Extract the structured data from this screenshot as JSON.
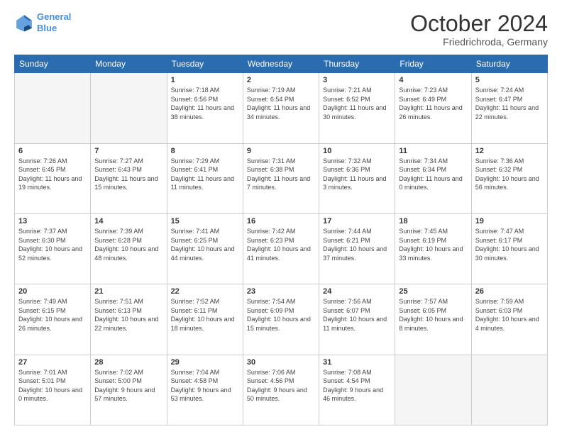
{
  "header": {
    "logo_line1": "General",
    "logo_line2": "Blue",
    "title": "October 2024",
    "subtitle": "Friedrichroda, Germany"
  },
  "weekdays": [
    "Sunday",
    "Monday",
    "Tuesday",
    "Wednesday",
    "Thursday",
    "Friday",
    "Saturday"
  ],
  "weeks": [
    [
      {
        "day": "",
        "sunrise": "",
        "sunset": "",
        "daylight": "",
        "empty": true
      },
      {
        "day": "",
        "sunrise": "",
        "sunset": "",
        "daylight": "",
        "empty": true
      },
      {
        "day": "1",
        "sunrise": "Sunrise: 7:18 AM",
        "sunset": "Sunset: 6:56 PM",
        "daylight": "Daylight: 11 hours and 38 minutes.",
        "empty": false
      },
      {
        "day": "2",
        "sunrise": "Sunrise: 7:19 AM",
        "sunset": "Sunset: 6:54 PM",
        "daylight": "Daylight: 11 hours and 34 minutes.",
        "empty": false
      },
      {
        "day": "3",
        "sunrise": "Sunrise: 7:21 AM",
        "sunset": "Sunset: 6:52 PM",
        "daylight": "Daylight: 11 hours and 30 minutes.",
        "empty": false
      },
      {
        "day": "4",
        "sunrise": "Sunrise: 7:23 AM",
        "sunset": "Sunset: 6:49 PM",
        "daylight": "Daylight: 11 hours and 26 minutes.",
        "empty": false
      },
      {
        "day": "5",
        "sunrise": "Sunrise: 7:24 AM",
        "sunset": "Sunset: 6:47 PM",
        "daylight": "Daylight: 11 hours and 22 minutes.",
        "empty": false
      }
    ],
    [
      {
        "day": "6",
        "sunrise": "Sunrise: 7:26 AM",
        "sunset": "Sunset: 6:45 PM",
        "daylight": "Daylight: 11 hours and 19 minutes.",
        "empty": false
      },
      {
        "day": "7",
        "sunrise": "Sunrise: 7:27 AM",
        "sunset": "Sunset: 6:43 PM",
        "daylight": "Daylight: 11 hours and 15 minutes.",
        "empty": false
      },
      {
        "day": "8",
        "sunrise": "Sunrise: 7:29 AM",
        "sunset": "Sunset: 6:41 PM",
        "daylight": "Daylight: 11 hours and 11 minutes.",
        "empty": false
      },
      {
        "day": "9",
        "sunrise": "Sunrise: 7:31 AM",
        "sunset": "Sunset: 6:38 PM",
        "daylight": "Daylight: 11 hours and 7 minutes.",
        "empty": false
      },
      {
        "day": "10",
        "sunrise": "Sunrise: 7:32 AM",
        "sunset": "Sunset: 6:36 PM",
        "daylight": "Daylight: 11 hours and 3 minutes.",
        "empty": false
      },
      {
        "day": "11",
        "sunrise": "Sunrise: 7:34 AM",
        "sunset": "Sunset: 6:34 PM",
        "daylight": "Daylight: 11 hours and 0 minutes.",
        "empty": false
      },
      {
        "day": "12",
        "sunrise": "Sunrise: 7:36 AM",
        "sunset": "Sunset: 6:32 PM",
        "daylight": "Daylight: 10 hours and 56 minutes.",
        "empty": false
      }
    ],
    [
      {
        "day": "13",
        "sunrise": "Sunrise: 7:37 AM",
        "sunset": "Sunset: 6:30 PM",
        "daylight": "Daylight: 10 hours and 52 minutes.",
        "empty": false
      },
      {
        "day": "14",
        "sunrise": "Sunrise: 7:39 AM",
        "sunset": "Sunset: 6:28 PM",
        "daylight": "Daylight: 10 hours and 48 minutes.",
        "empty": false
      },
      {
        "day": "15",
        "sunrise": "Sunrise: 7:41 AM",
        "sunset": "Sunset: 6:25 PM",
        "daylight": "Daylight: 10 hours and 44 minutes.",
        "empty": false
      },
      {
        "day": "16",
        "sunrise": "Sunrise: 7:42 AM",
        "sunset": "Sunset: 6:23 PM",
        "daylight": "Daylight: 10 hours and 41 minutes.",
        "empty": false
      },
      {
        "day": "17",
        "sunrise": "Sunrise: 7:44 AM",
        "sunset": "Sunset: 6:21 PM",
        "daylight": "Daylight: 10 hours and 37 minutes.",
        "empty": false
      },
      {
        "day": "18",
        "sunrise": "Sunrise: 7:45 AM",
        "sunset": "Sunset: 6:19 PM",
        "daylight": "Daylight: 10 hours and 33 minutes.",
        "empty": false
      },
      {
        "day": "19",
        "sunrise": "Sunrise: 7:47 AM",
        "sunset": "Sunset: 6:17 PM",
        "daylight": "Daylight: 10 hours and 30 minutes.",
        "empty": false
      }
    ],
    [
      {
        "day": "20",
        "sunrise": "Sunrise: 7:49 AM",
        "sunset": "Sunset: 6:15 PM",
        "daylight": "Daylight: 10 hours and 26 minutes.",
        "empty": false
      },
      {
        "day": "21",
        "sunrise": "Sunrise: 7:51 AM",
        "sunset": "Sunset: 6:13 PM",
        "daylight": "Daylight: 10 hours and 22 minutes.",
        "empty": false
      },
      {
        "day": "22",
        "sunrise": "Sunrise: 7:52 AM",
        "sunset": "Sunset: 6:11 PM",
        "daylight": "Daylight: 10 hours and 18 minutes.",
        "empty": false
      },
      {
        "day": "23",
        "sunrise": "Sunrise: 7:54 AM",
        "sunset": "Sunset: 6:09 PM",
        "daylight": "Daylight: 10 hours and 15 minutes.",
        "empty": false
      },
      {
        "day": "24",
        "sunrise": "Sunrise: 7:56 AM",
        "sunset": "Sunset: 6:07 PM",
        "daylight": "Daylight: 10 hours and 11 minutes.",
        "empty": false
      },
      {
        "day": "25",
        "sunrise": "Sunrise: 7:57 AM",
        "sunset": "Sunset: 6:05 PM",
        "daylight": "Daylight: 10 hours and 8 minutes.",
        "empty": false
      },
      {
        "day": "26",
        "sunrise": "Sunrise: 7:59 AM",
        "sunset": "Sunset: 6:03 PM",
        "daylight": "Daylight: 10 hours and 4 minutes.",
        "empty": false
      }
    ],
    [
      {
        "day": "27",
        "sunrise": "Sunrise: 7:01 AM",
        "sunset": "Sunset: 5:01 PM",
        "daylight": "Daylight: 10 hours and 0 minutes.",
        "empty": false
      },
      {
        "day": "28",
        "sunrise": "Sunrise: 7:02 AM",
        "sunset": "Sunset: 5:00 PM",
        "daylight": "Daylight: 9 hours and 57 minutes.",
        "empty": false
      },
      {
        "day": "29",
        "sunrise": "Sunrise: 7:04 AM",
        "sunset": "Sunset: 4:58 PM",
        "daylight": "Daylight: 9 hours and 53 minutes.",
        "empty": false
      },
      {
        "day": "30",
        "sunrise": "Sunrise: 7:06 AM",
        "sunset": "Sunset: 4:56 PM",
        "daylight": "Daylight: 9 hours and 50 minutes.",
        "empty": false
      },
      {
        "day": "31",
        "sunrise": "Sunrise: 7:08 AM",
        "sunset": "Sunset: 4:54 PM",
        "daylight": "Daylight: 9 hours and 46 minutes.",
        "empty": false
      },
      {
        "day": "",
        "sunrise": "",
        "sunset": "",
        "daylight": "",
        "empty": true
      },
      {
        "day": "",
        "sunrise": "",
        "sunset": "",
        "daylight": "",
        "empty": true
      }
    ]
  ]
}
